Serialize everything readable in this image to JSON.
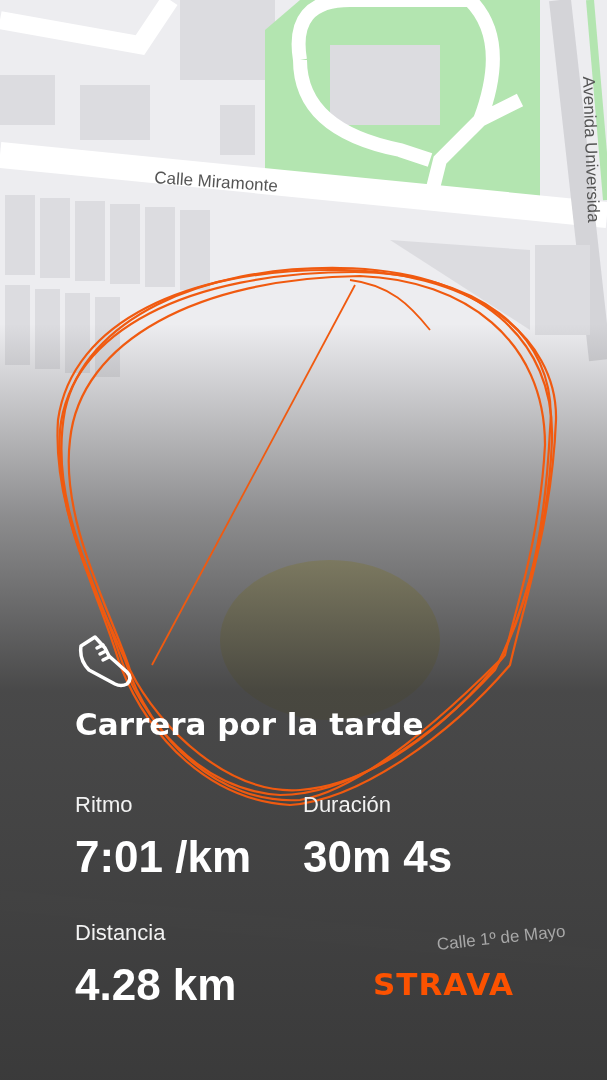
{
  "map": {
    "labels": [
      {
        "kind": "street",
        "text": "Calle Miramonte"
      },
      {
        "kind": "avenue",
        "text": "Avenida Universida"
      },
      {
        "kind": "street-low",
        "text": "Calle 1º de Mayo"
      }
    ]
  },
  "activity": {
    "title": "Carrera por la tarde",
    "stats": [
      {
        "label": "Ritmo",
        "value": "7:01 /km"
      },
      {
        "label": "Duración",
        "value": "30m 4s"
      },
      {
        "label": "Distancia",
        "value": "4.28 km"
      }
    ]
  },
  "brand": {
    "logo": "STRAVA"
  }
}
